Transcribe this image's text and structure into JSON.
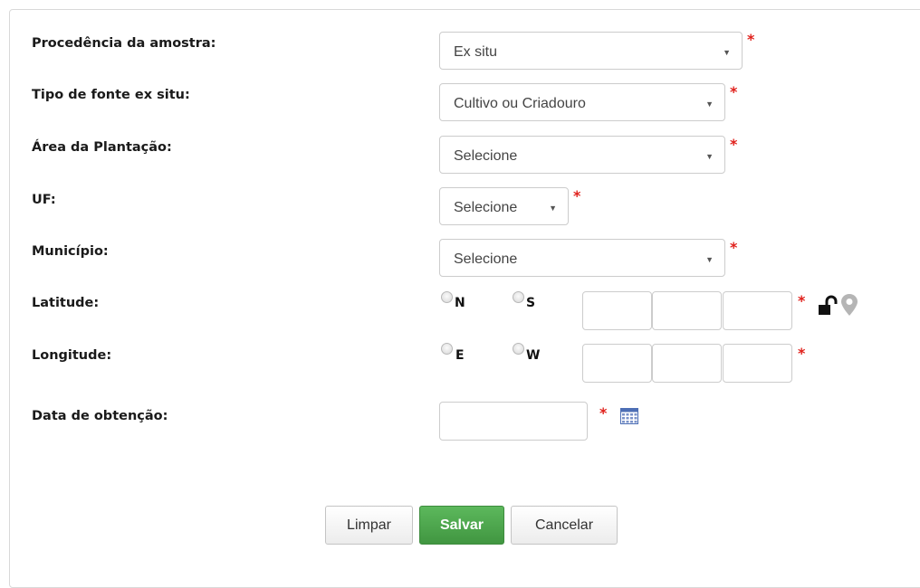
{
  "form": {
    "procedencia": {
      "label": "Procedência da amostra:",
      "value": "Ex situ"
    },
    "tipo_fonte": {
      "label": "Tipo de fonte ex situ:",
      "value": "Cultivo ou Criadouro"
    },
    "area": {
      "label": "Área da Plantação:",
      "value": "Selecione"
    },
    "uf": {
      "label": "UF:",
      "value": "Selecione"
    },
    "municipio": {
      "label": "Município:",
      "value": "Selecione"
    },
    "latitude": {
      "label": "Latitude:",
      "opt_n": "N",
      "opt_s": "S"
    },
    "longitude": {
      "label": "Longitude:",
      "opt_e": "E",
      "opt_w": "W"
    },
    "data": {
      "label": "Data de obtenção:"
    },
    "required_mark": "*"
  },
  "buttons": {
    "limpar": "Limpar",
    "salvar": "Salvar",
    "cancelar": "Cancelar"
  },
  "colors": {
    "required": "#e0201b",
    "primary": "#5cb85c"
  },
  "icons": [
    "unlock-icon",
    "location-pin-icon",
    "calendar-icon"
  ]
}
